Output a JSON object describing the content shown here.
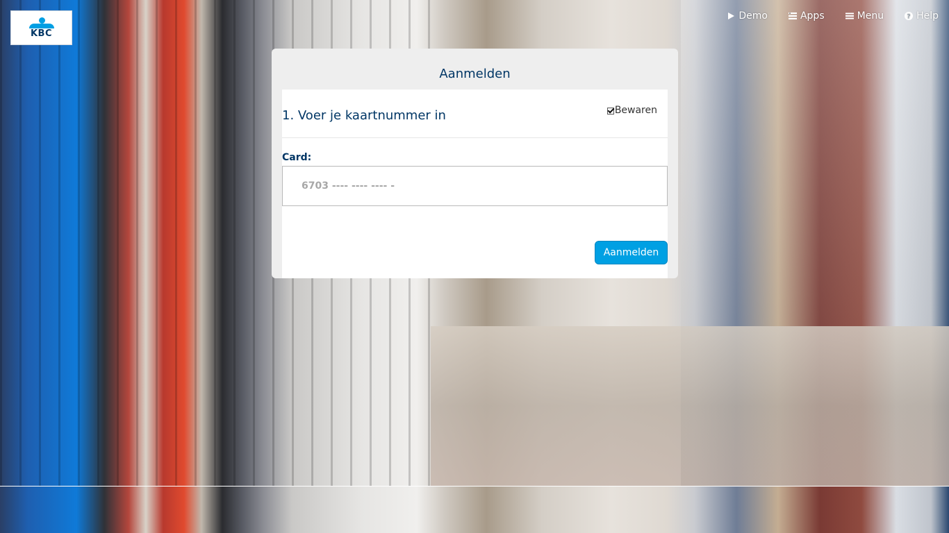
{
  "brand": {
    "logo_text": "KBC"
  },
  "nav": {
    "items": [
      {
        "label": "Demo",
        "icon": "play-icon"
      },
      {
        "label": "Apps",
        "icon": "apps-list-icon"
      },
      {
        "label": "Menu",
        "icon": "menu-icon"
      },
      {
        "label": "Help",
        "icon": "help-circle-icon"
      }
    ]
  },
  "login": {
    "title": "Aanmelden",
    "step_title": "1. Voer je kaartnummer in",
    "save_label": "Bewaren",
    "save_checked": true,
    "card_label": "Card:",
    "card_placeholder": "6703 ---- ---- ---- -",
    "submit_label": "Aanmelden"
  },
  "colors": {
    "brand_navy": "#003665",
    "brand_blue": "#009fe3",
    "button_blue": "#00a0e3",
    "card_bg": "#eeeeee"
  }
}
